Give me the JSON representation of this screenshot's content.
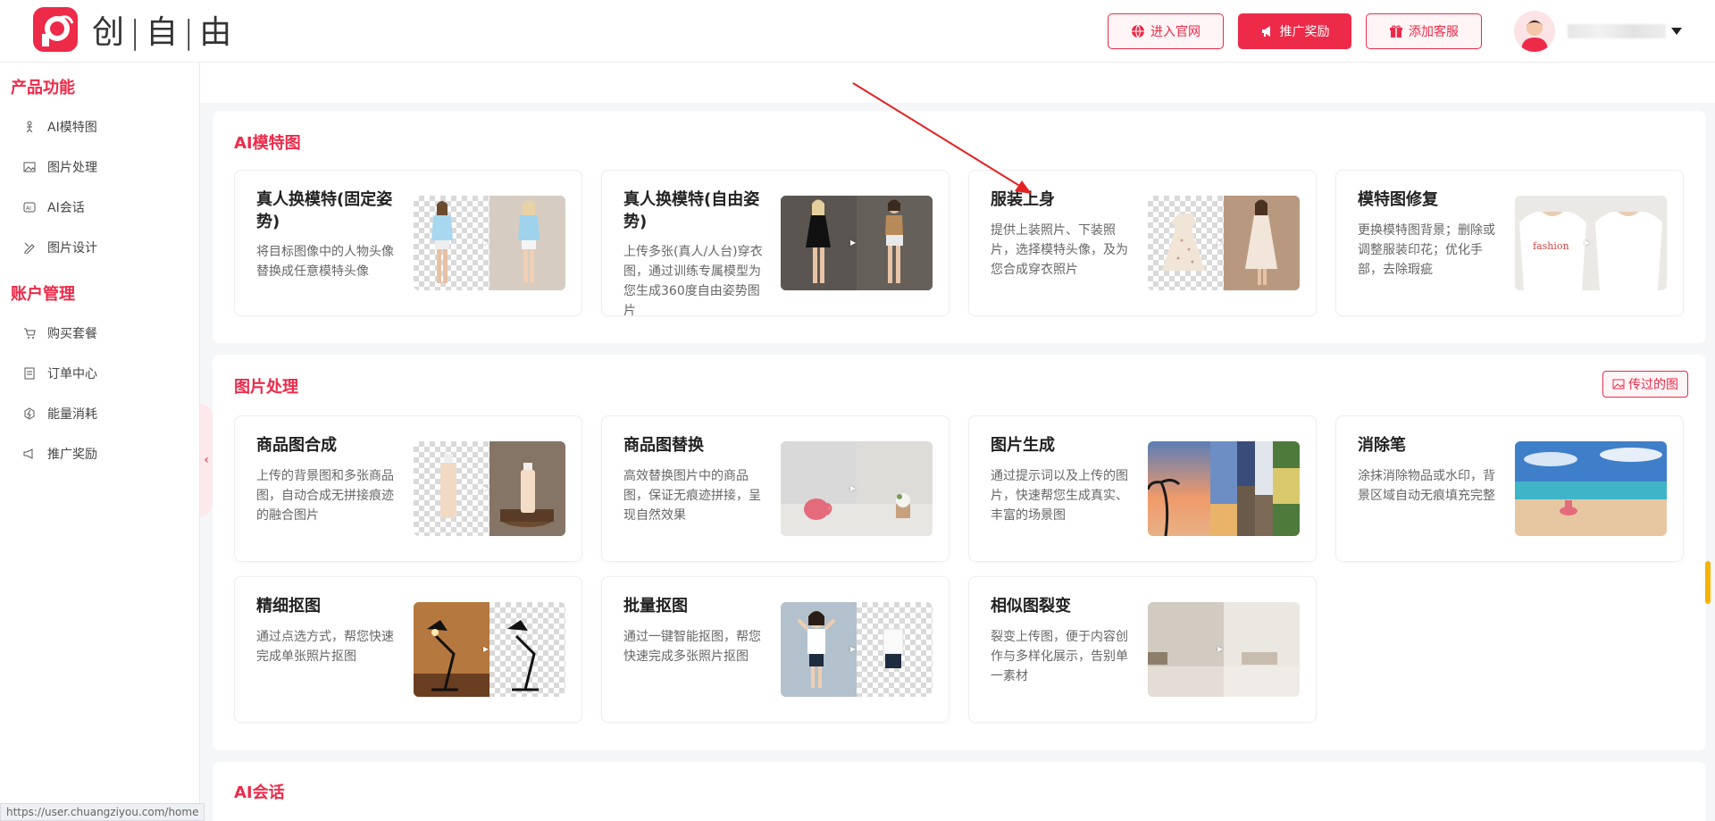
{
  "header": {
    "logo_text": "创|自|由",
    "buttons": [
      {
        "label": "进入官网",
        "icon": "globe-icon"
      },
      {
        "label": "推广奖励",
        "icon": "megaphone-icon"
      },
      {
        "label": "添加客服",
        "icon": "gift-icon"
      }
    ]
  },
  "sidebar": {
    "sections": [
      {
        "title": "产品功能",
        "items": [
          {
            "label": "AI模特图",
            "icon": "model-icon"
          },
          {
            "label": "图片处理",
            "icon": "image-icon"
          },
          {
            "label": "AI会话",
            "icon": "ai-chat-icon"
          },
          {
            "label": "图片设计",
            "icon": "design-icon"
          }
        ]
      },
      {
        "title": "账户管理",
        "items": [
          {
            "label": "购买套餐",
            "icon": "cart-icon"
          },
          {
            "label": "订单中心",
            "icon": "order-icon"
          },
          {
            "label": "能量消耗",
            "icon": "energy-icon"
          },
          {
            "label": "推广奖励",
            "icon": "megaphone-icon"
          }
        ]
      }
    ]
  },
  "status_url": "https://user.chuangziyou.com/home",
  "main": {
    "ai_model": {
      "title": "AI模特图",
      "cards": [
        {
          "title": "真人换模特(固定姿势)",
          "desc": "将目标图像中的人物头像替换成任意模特头像"
        },
        {
          "title": "真人换模特(自由姿势)",
          "desc": "上传多张(真人/人台)穿衣图，通过训练专属模型为您生成360度自由姿势图片"
        },
        {
          "title": "服装上身",
          "desc": "提供上装照片、下装照片，选择模特头像，及为您合成穿衣照片"
        },
        {
          "title": "模特图修复",
          "desc": "更换模特图背景；删除或调整服装印花；优化手部，去除瑕疵"
        }
      ]
    },
    "image_processing": {
      "title": "图片处理",
      "upload_button": "传过的图",
      "cards": [
        {
          "title": "商品图合成",
          "desc": "上传的背景图和多张商品图，自动合成无拼接痕迹的融合图片"
        },
        {
          "title": "商品图替换",
          "desc": "高效替换图片中的商品图，保证无痕迹拼接，呈现自然效果"
        },
        {
          "title": "图片生成",
          "desc": "通过提示词以及上传的图片，快速帮您生成真实、丰富的场景图"
        },
        {
          "title": "消除笔",
          "desc": "涂抹消除物品或水印，背景区域自动无痕填充完整"
        },
        {
          "title": "精细抠图",
          "desc": "通过点选方式，帮您快速完成单张照片抠图"
        },
        {
          "title": "批量抠图",
          "desc": "通过一键智能抠图，帮您快速完成多张照片抠图"
        },
        {
          "title": "相似图裂变",
          "desc": "裂变上传图，便于内容创作与多样化展示，告别单一素材"
        }
      ]
    },
    "ai_chat": {
      "title": "AI会话"
    }
  },
  "colors": {
    "accent": "#ee2a49"
  }
}
